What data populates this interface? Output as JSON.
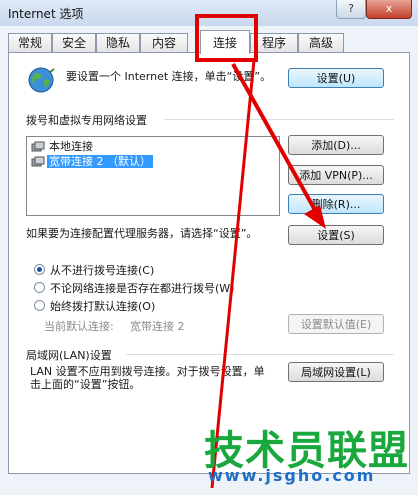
{
  "window": {
    "title": "Internet 选项",
    "help_button": "?",
    "close_button": "x"
  },
  "tabs": [
    "常规",
    "安全",
    "隐私",
    "内容",
    "连接",
    "程序",
    "高级"
  ],
  "setup": {
    "text": "要设置一个 Internet 连接，单击“设置”。",
    "button": "设置(U)"
  },
  "dialup": {
    "heading": "拨号和虚拟专用网络设置",
    "connections": [
      {
        "name": "本地连接",
        "selected": false
      },
      {
        "name": "宽带连接 2 （默认）",
        "selected": true
      }
    ],
    "add_button": "添加(D)...",
    "add_vpn_button": "添加 VPN(P)...",
    "remove_button": "删除(R)...",
    "proxy_text": "如果要为连接配置代理服务器，请选择“设置”。",
    "settings_button": "设置(S)",
    "options": [
      {
        "label": "从不进行拨号连接(C)",
        "checked": true
      },
      {
        "label": "不论网络连接是否存在都进行拨号(W)",
        "checked": false
      },
      {
        "label": "始终拨打默认连接(O)",
        "checked": false
      }
    ],
    "current_default_label": "当前默认连接:",
    "current_default_value": "宽带连接 2",
    "set_default_button": "设置默认值(E)"
  },
  "lan": {
    "heading": "局域网(LAN)设置",
    "text": "LAN 设置不应用到拨号连接。对于拨号设置，单击上面的“设置”按钮。",
    "button": "局域网设置(L)"
  },
  "watermark": {
    "brand": "技术员联盟",
    "url": "www.jsgho.com"
  },
  "colors": {
    "annotation_red": "#e10000",
    "selection_blue": "#3399ff"
  }
}
